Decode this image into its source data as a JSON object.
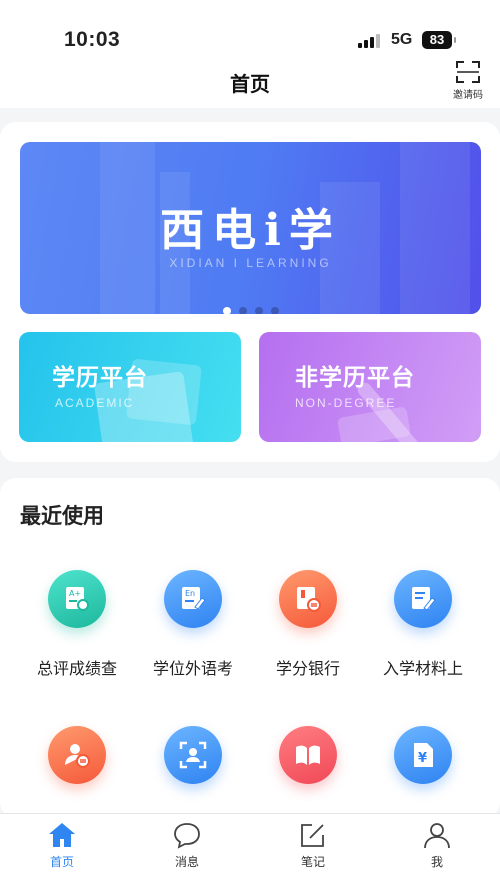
{
  "status_bar": {
    "time": "10:03",
    "network": "5G",
    "battery": "83"
  },
  "header": {
    "title": "首页",
    "invite_label": "邀请码"
  },
  "banner": {
    "title": "西电i学",
    "subtitle": "XIDIAN I LEARNING",
    "page_count": 4,
    "active_index": 0
  },
  "platforms": {
    "academic": {
      "title": "学历平台",
      "subtitle": "ACADEMIC"
    },
    "non_degree": {
      "title": "非学历平台",
      "subtitle": "NON-DEGREE"
    }
  },
  "recent": {
    "title": "最近使用",
    "items": [
      {
        "label": "总评成绩查",
        "icon": "grade-report-icon",
        "color": "#1db89e"
      },
      {
        "label": "学位外语考",
        "icon": "english-exam-icon",
        "color": "#2f83f2"
      },
      {
        "label": "学分银行",
        "icon": "credit-bank-icon",
        "color": "#f5593a"
      },
      {
        "label": "入学材料上",
        "icon": "document-edit-icon",
        "color": "#2f83f2"
      },
      {
        "label": "",
        "icon": "user-switch-icon",
        "color": "#f5593a"
      },
      {
        "label": "",
        "icon": "face-scan-icon",
        "color": "#2f83f2"
      },
      {
        "label": "",
        "icon": "open-book-icon",
        "color": "#f04856"
      },
      {
        "label": "",
        "icon": "yuan-document-icon",
        "color": "#2f83f2"
      }
    ]
  },
  "tabbar": {
    "items": [
      {
        "label": "首页",
        "icon": "home-icon",
        "active": true
      },
      {
        "label": "消息",
        "icon": "message-icon",
        "active": false
      },
      {
        "label": "笔记",
        "icon": "note-icon",
        "active": false
      },
      {
        "label": "我",
        "icon": "user-icon",
        "active": false
      }
    ],
    "active_color": "#2f86f0"
  }
}
